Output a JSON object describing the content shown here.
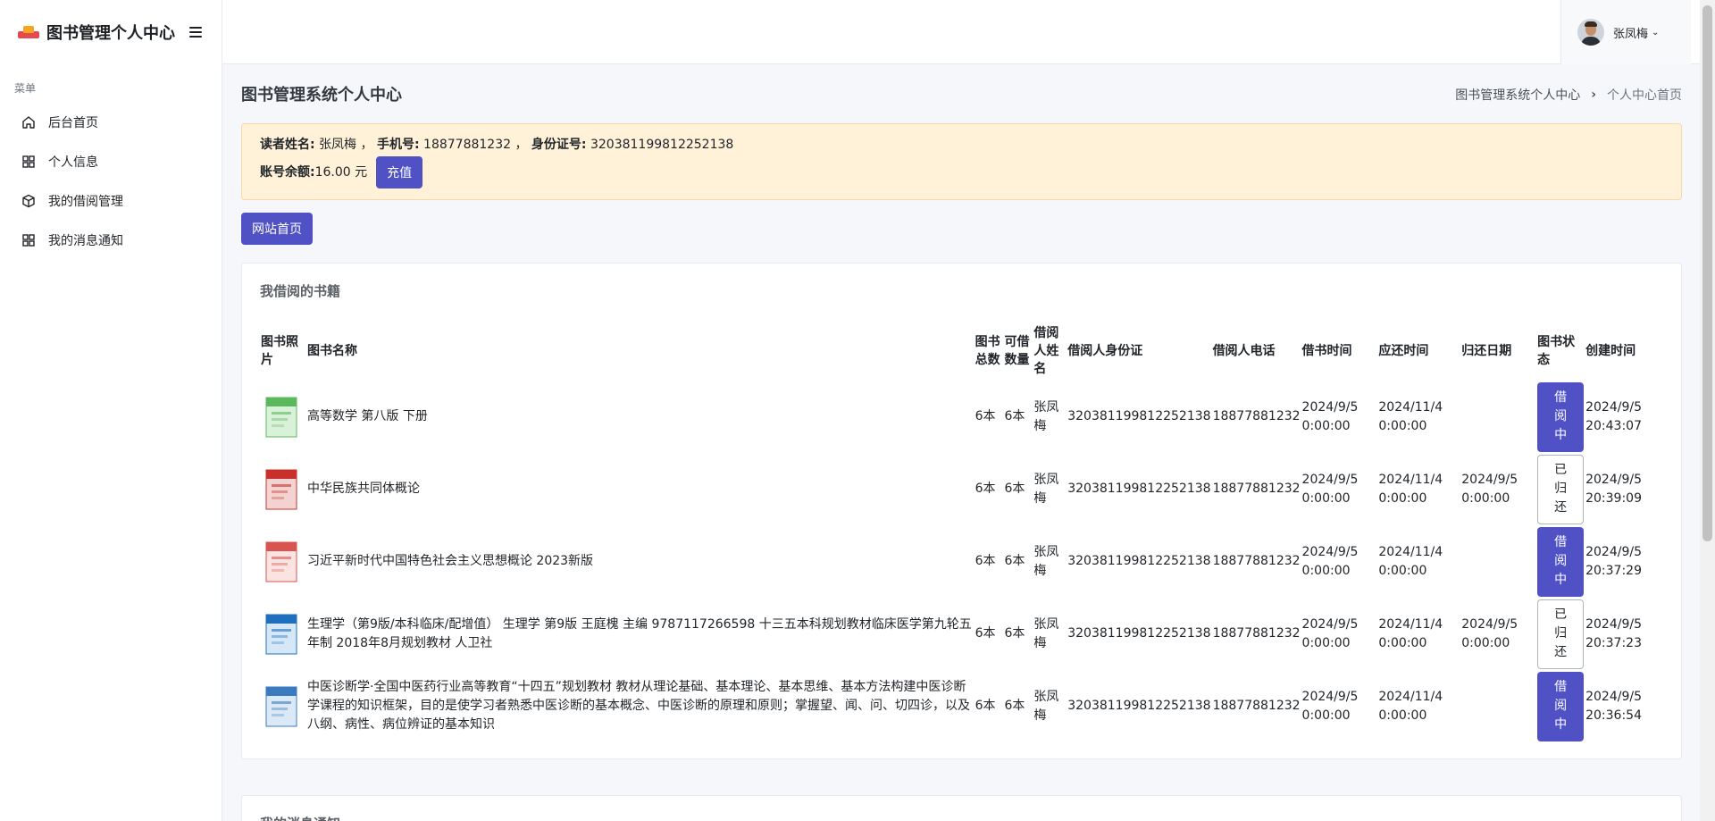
{
  "brand": {
    "title": "图书管理个人中心"
  },
  "sidebar": {
    "menu_header": "菜单",
    "items": [
      {
        "label": "后台首页",
        "icon": "home-icon"
      },
      {
        "label": "个人信息",
        "icon": "grid-icon"
      },
      {
        "label": "我的借阅管理",
        "icon": "box-icon"
      },
      {
        "label": "我的消息通知",
        "icon": "grid-icon"
      }
    ]
  },
  "user": {
    "name": "张凤梅"
  },
  "page": {
    "title": "图书管理系统个人中心",
    "breadcrumb": [
      "图书管理系统个人中心",
      "个人中心首页"
    ]
  },
  "reader": {
    "name_label": "读者姓名:",
    "name": "张凤梅",
    "phone_label": "手机号:",
    "phone": "18877881232",
    "id_label": "身份证号:",
    "id": "320381199812252138",
    "balance_label": "账号余额:",
    "balance": "16.00 元",
    "charge_button": "充值"
  },
  "site_button": "网站首页",
  "borrow": {
    "title": "我借阅的书籍",
    "headers": [
      "图书照片",
      "图书名称",
      "图书总数",
      "可借数量",
      "借阅人姓名",
      "借阅人身份证",
      "借阅人电话",
      "借书时间",
      "应还时间",
      "归还日期",
      "图书状态",
      "创建时间"
    ],
    "rows": [
      {
        "name": "高等数学 第八版 下册",
        "total": "6本",
        "available": "6本",
        "borrower": "张凤梅",
        "id": "320381199812252138",
        "phone": "18877881232",
        "borrow_time": "2024/9/5 0:00:00",
        "due_time": "2024/11/4 0:00:00",
        "return_date": "",
        "status": "借阅中",
        "created": "2024/9/5 20:43:07"
      },
      {
        "name": "中华民族共同体概论",
        "total": "6本",
        "available": "6本",
        "borrower": "张凤梅",
        "id": "320381199812252138",
        "phone": "18877881232",
        "borrow_time": "2024/9/5 0:00:00",
        "due_time": "2024/11/4 0:00:00",
        "return_date": "2024/9/5 0:00:00",
        "status": "已归还",
        "created": "2024/9/5 20:39:09"
      },
      {
        "name": "习近平新时代中国特色社会主义思想概论 2023新版",
        "total": "6本",
        "available": "6本",
        "borrower": "张凤梅",
        "id": "320381199812252138",
        "phone": "18877881232",
        "borrow_time": "2024/9/5 0:00:00",
        "due_time": "2024/11/4 0:00:00",
        "return_date": "",
        "status": "借阅中",
        "created": "2024/9/5 20:37:29"
      },
      {
        "name": "生理学（第9版/本科临床/配增值） 生理学 第9版 王庭槐 主编 9787117266598 十三五本科规划教材临床医学第九轮五年制 2018年8月规划教材 人卫社",
        "total": "6本",
        "available": "6本",
        "borrower": "张凤梅",
        "id": "320381199812252138",
        "phone": "18877881232",
        "borrow_time": "2024/9/5 0:00:00",
        "due_time": "2024/11/4 0:00:00",
        "return_date": "2024/9/5 0:00:00",
        "status": "已归还",
        "created": "2024/9/5 20:37:23"
      },
      {
        "name": "中医诊断学·全国中医药行业高等教育“十四五”规划教材 教材从理论基础、基本理论、基本思维、基本方法构建中医诊断学课程的知识框架，目的是使学习者熟悉中医诊断的基本概念、中医诊断的原理和原则；掌握望、闻、问、切四诊，以及八纲、病性、病位辨证的基本知识",
        "total": "6本",
        "available": "6本",
        "borrower": "张凤梅",
        "id": "320381199812252138",
        "phone": "18877881232",
        "borrow_time": "2024/9/5 0:00:00",
        "due_time": "2024/11/4 0:00:00",
        "return_date": "",
        "status": "借阅中",
        "created": "2024/9/5 20:36:54"
      }
    ],
    "book_colors": [
      [
        "#5cb85c",
        "#d9f0d9"
      ],
      [
        "#c9302c",
        "#f3d3d2"
      ],
      [
        "#d9534f",
        "#fbe3e2"
      ],
      [
        "#1f6fbf",
        "#d6e8f8"
      ],
      [
        "#3a7bbf",
        "#dbe9f6"
      ]
    ]
  },
  "messages": {
    "title": "我的消息通知"
  }
}
